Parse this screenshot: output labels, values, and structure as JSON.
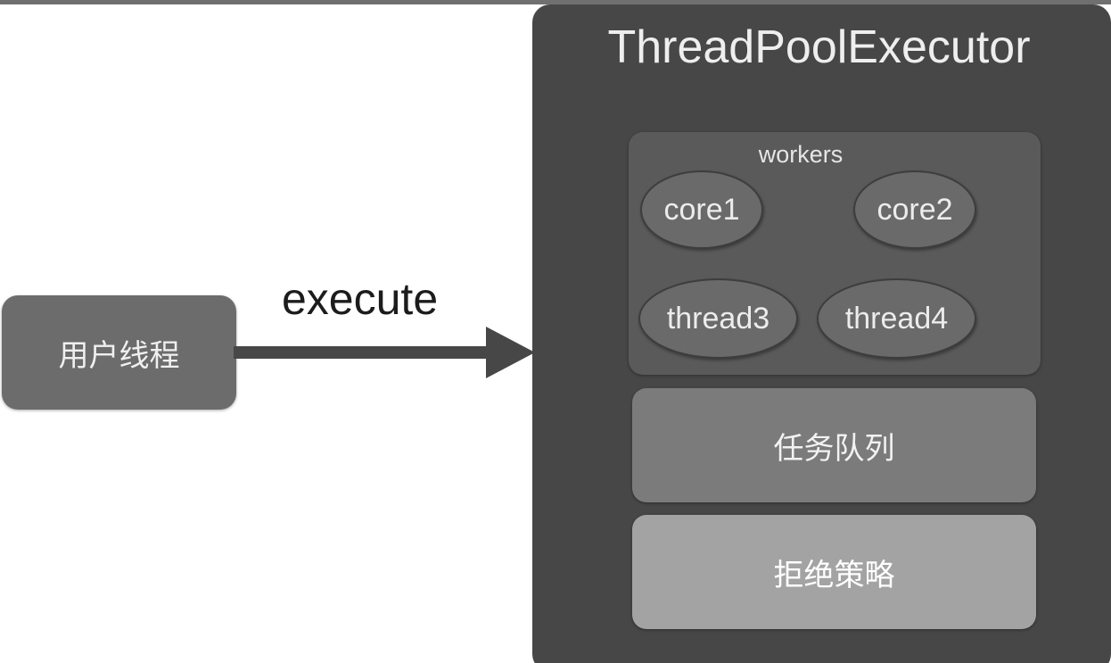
{
  "user_thread": {
    "label": "用户线程"
  },
  "arrow": {
    "label": "execute"
  },
  "executor": {
    "title": "ThreadPoolExecutor",
    "workers": {
      "label": "workers",
      "items": [
        "core1",
        "core2",
        "thread3",
        "thread4"
      ]
    },
    "task_queue": "任务队列",
    "reject_policy": "拒绝策略"
  },
  "colors": {
    "executor_bg": "#474747",
    "workers_bg": "#5a5a5a",
    "worker_bg": "#6a6a6a",
    "user_thread_bg": "#6c6c6c",
    "task_queue_bg": "#7b7b7b",
    "reject_policy_bg": "#a3a3a3",
    "arrow": "#474747"
  }
}
